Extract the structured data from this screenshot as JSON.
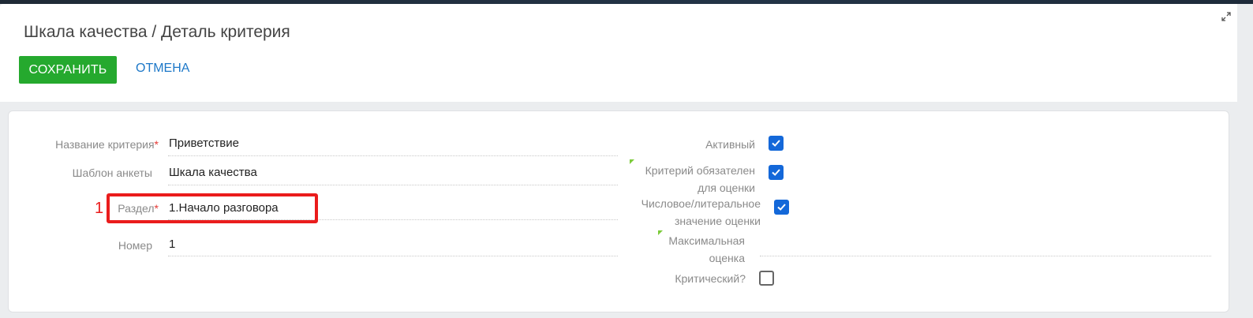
{
  "header": {
    "title": "Шкала качества / Деталь критерия",
    "save_label": "СОХРАНИТЬ",
    "cancel_label": "ОТМЕНА"
  },
  "form": {
    "name_label": "Название критерия",
    "name_value": "Приветствие",
    "template_label": "Шаблон анкеты",
    "template_value": "Шкала качества",
    "section_label": "Раздел",
    "section_value": "1.Начало разговора",
    "number_label": "Номер",
    "number_value": "1",
    "required_marker": "*",
    "active_label": "Активный",
    "active_checked": true,
    "mandatory_label_line1": "Критерий обязателен",
    "mandatory_label_line2": "для оценки",
    "mandatory_checked": true,
    "numeric_label_line1": "Числовое/литеральное",
    "numeric_label_line2": "значение оценки",
    "numeric_checked": true,
    "max_score_label_line1": "Максимальная",
    "max_score_label_line2": "оценка",
    "max_score_value": "",
    "critical_label": "Критический?",
    "critical_checked": false
  },
  "annotation": {
    "number": "1",
    "color": "#ea1c1c"
  },
  "colors": {
    "accent_green": "#25a92e",
    "link_blue": "#1d78c8",
    "checkbox_blue": "#1468d9",
    "required_red": "#e53935",
    "hint_green": "#7ccb3a"
  }
}
